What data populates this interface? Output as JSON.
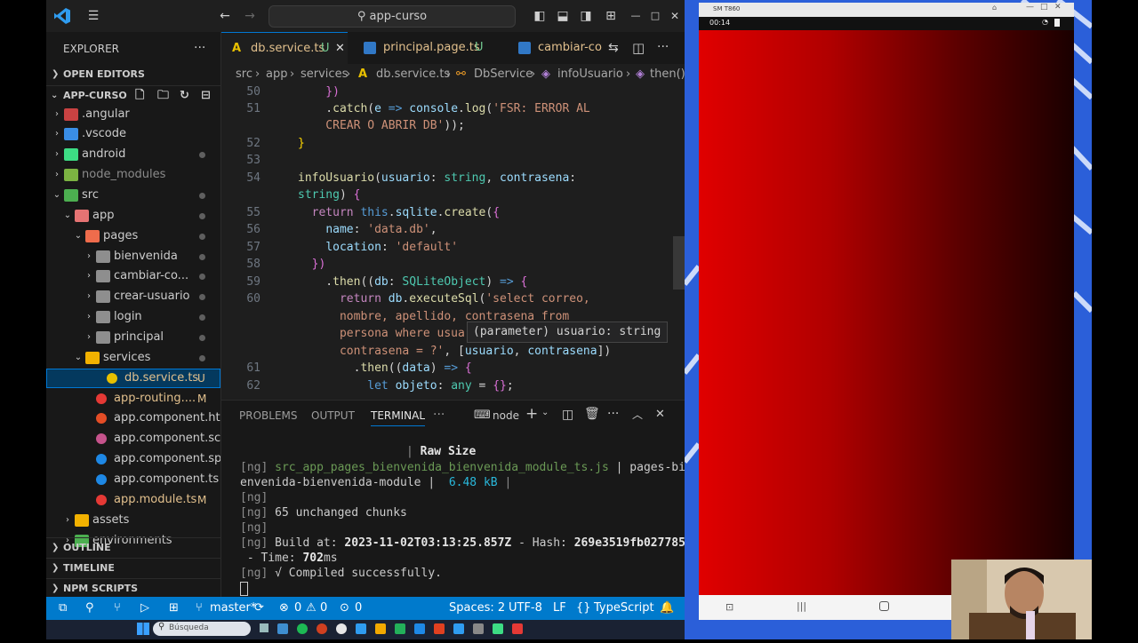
{
  "window": {
    "search": "app-curso"
  },
  "explorer": {
    "title": "EXPLORER",
    "more": "···",
    "open_editors": "OPEN EDITORS",
    "project": "APP-CURSO",
    "items": [
      {
        "label": ".angular",
        "badge": ""
      },
      {
        "label": ".vscode",
        "badge": ""
      },
      {
        "label": "android",
        "badge": ""
      },
      {
        "label": "node_modules",
        "badge": ""
      },
      {
        "label": "src",
        "badge": ""
      },
      {
        "label": "app",
        "badge": ""
      },
      {
        "label": "pages",
        "badge": ""
      },
      {
        "label": "bienvenida",
        "badge": ""
      },
      {
        "label": "cambiar-co...",
        "badge": ""
      },
      {
        "label": "crear-usuario",
        "badge": ""
      },
      {
        "label": "login",
        "badge": ""
      },
      {
        "label": "principal",
        "badge": ""
      },
      {
        "label": "services",
        "badge": ""
      },
      {
        "label": "db.service.ts",
        "badge": "U"
      },
      {
        "label": "app-routing....",
        "badge": "M"
      },
      {
        "label": "app.component.html",
        "badge": ""
      },
      {
        "label": "app.component.scss",
        "badge": ""
      },
      {
        "label": "app.component.sp...",
        "badge": ""
      },
      {
        "label": "app.component.ts",
        "badge": ""
      },
      {
        "label": "app.module.ts",
        "badge": "M"
      },
      {
        "label": "assets",
        "badge": ""
      },
      {
        "label": "environments",
        "badge": ""
      }
    ],
    "outline": "OUTLINE",
    "timeline": "TIMELINE",
    "npm": "NPM SCRIPTS"
  },
  "tabs": [
    {
      "label": "db.service.ts",
      "badge": "U"
    },
    {
      "label": "principal.page.ts",
      "badge": "U"
    },
    {
      "label": "cambiar-cor",
      "badge": ""
    }
  ],
  "breadcrumb": [
    "src",
    "app",
    "services",
    "db.service.ts",
    "DbService",
    "infoUsuario",
    "then()"
  ],
  "hover": {
    "text": "(parameter) usuario: string"
  },
  "panel": {
    "tabs": [
      "PROBLEMS",
      "OUTPUT",
      "TERMINAL"
    ],
    "more": "···",
    "shell": "node",
    "lines": {
      "l1": "Raw Size",
      "l2a": "[ng]",
      "l2b": "src_app_pages_bienvenida_bienvenida_module_ts.js",
      "l2c": "| pages-bi",
      "l3a": "envenida-bienvenida-module",
      "l3b": "|",
      "l3c": "6.48 kB",
      "l3d": "|",
      "l4": "[ng]",
      "l5a": "[ng]",
      "l5b": "65 unchanged chunks",
      "l6": "[ng]",
      "l7a": "[ng]",
      "l7b": "Build at:",
      "l7c": "2023-11-02T03:13:25.857Z",
      "l7d": "- Hash:",
      "l7e": "269e3519fb027785",
      "l8a": " - Time:",
      "l8b": "702",
      "l8c": "ms",
      "l9a": "[ng]",
      "l9b": "√ Compiled successfully.",
      "l10": "[ng]"
    }
  },
  "status": {
    "branch": "master*",
    "errors": "0",
    "warnings": "0",
    "ports": "0",
    "spaces": "Spaces: 2",
    "encoding": "UTF-8",
    "eol": "LF",
    "language": "TypeScript"
  },
  "taskbar": {
    "search": "Búsqueda"
  },
  "phone": {
    "device": "SM T860",
    "time": "00:14"
  },
  "colors": {
    "accent": "#007acc",
    "phone_screen": "#d00000",
    "sidebar": "#181818",
    "editor": "#1e1e1e"
  }
}
